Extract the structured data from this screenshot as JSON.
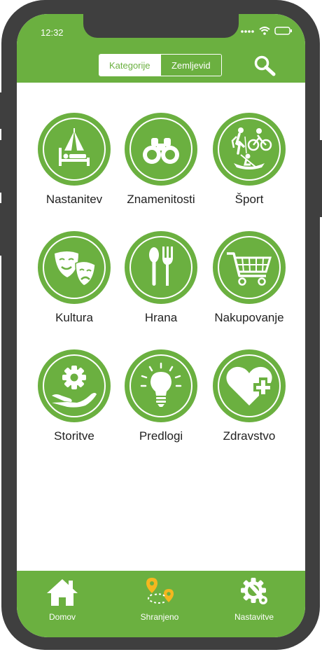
{
  "status_bar": {
    "time": "12:32"
  },
  "header": {
    "segmented": {
      "active": "Kategorije",
      "inactive": "Zemljevid"
    }
  },
  "categories": [
    {
      "label": "Nastanitev",
      "icon": "accommodation-tent-bed-icon"
    },
    {
      "label": "Znamenitosti",
      "icon": "binoculars-icon"
    },
    {
      "label": "Šport",
      "icon": "hiking-cycling-rafting-icon"
    },
    {
      "label": "Kultura",
      "icon": "theater-masks-icon"
    },
    {
      "label": "Hrana",
      "icon": "spoon-fork-icon"
    },
    {
      "label": "Nakupovanje",
      "icon": "shopping-cart-icon"
    },
    {
      "label": "Storitve",
      "icon": "gear-in-hand-icon"
    },
    {
      "label": "Predlogi",
      "icon": "lightbulb-icon"
    },
    {
      "label": "Zdravstvo",
      "icon": "heart-plus-icon"
    }
  ],
  "tabbar": [
    {
      "label": "Domov",
      "icon": "home-icon"
    },
    {
      "label": "Shranjeno",
      "icon": "saved-route-pins-icon"
    },
    {
      "label": "Nastavitve",
      "icon": "settings-wrench-gear-icon"
    }
  ],
  "colors": {
    "brand_green": "#6bb040",
    "frame": "#3f3f3f",
    "pin_yellow": "#f5b71f"
  }
}
